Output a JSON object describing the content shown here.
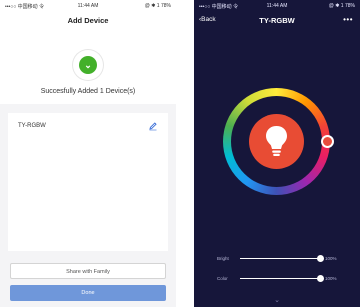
{
  "left": {
    "status": {
      "carrier": "•••○○ 中国移动 令",
      "time": "11:44 AM",
      "battery": "@ ✱ 1 78%"
    },
    "title": "Add Device",
    "success_text": "Succesfully Added 1 Device(s)",
    "device": {
      "name": "TY-RGBW"
    },
    "share_label": "Share with Family",
    "done_label": "Done",
    "colors": {
      "accent": "#6f97da",
      "success": "#43b02a"
    }
  },
  "right": {
    "status": {
      "carrier": "•••○○ 中国移动 令",
      "time": "11:44 AM",
      "battery": "@ ✱ 1 78%"
    },
    "back_label": "Back",
    "title": "TY-RGBW",
    "more_icon": "•••",
    "power_state": "on",
    "sliders": [
      {
        "label": "Bright",
        "value_text": "100%",
        "fraction": 1.0
      },
      {
        "label": "Color",
        "value_text": "100%",
        "fraction": 1.0
      }
    ],
    "colors": {
      "background": "#16163a",
      "power": "#e84c34"
    },
    "icons": {
      "bulb": "lightbulb-icon",
      "chevron": "chevron-down-icon"
    }
  }
}
